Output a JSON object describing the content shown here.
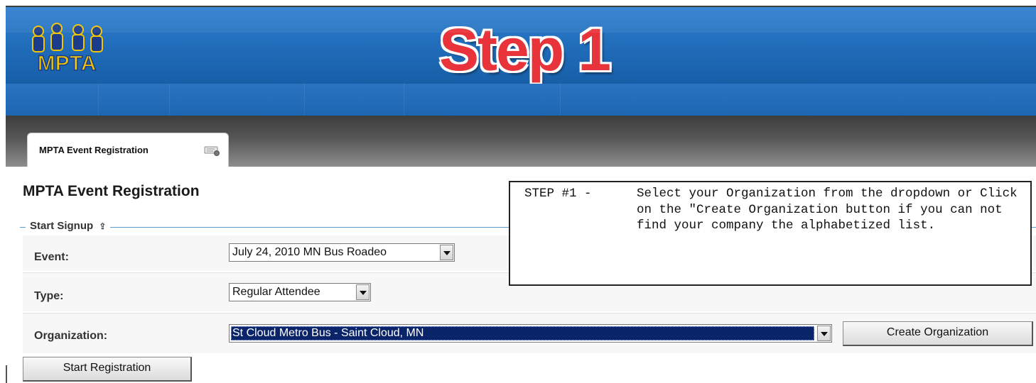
{
  "header": {
    "logo_text": "MPTA",
    "step_title": "Step 1"
  },
  "tabs": [
    {
      "label": "MPTA Event Registration"
    }
  ],
  "page": {
    "title": "MPTA Event Registration",
    "section_legend": "Start Signup",
    "section_legend_icon": "collapse-up-icon"
  },
  "form": {
    "event": {
      "label": "Event:",
      "value": "July 24, 2010 MN Bus Roadeo"
    },
    "type": {
      "label": "Type:",
      "value": "Regular Attendee"
    },
    "organization": {
      "label": "Organization:",
      "value": "St Cloud Metro Bus - Saint Cloud, MN"
    },
    "create_org_button": "Create Organization",
    "start_button": "Start Registration"
  },
  "callout": {
    "prefix": "STEP #1 -",
    "text": "Select your Organization from the dropdown or Click on the \"Create Organization button if you can not find your company the alphabetized list."
  },
  "colors": {
    "header_blue": "#1f6bb8",
    "step_red": "#e8333a",
    "selected_option_bg": "#0a246a"
  }
}
